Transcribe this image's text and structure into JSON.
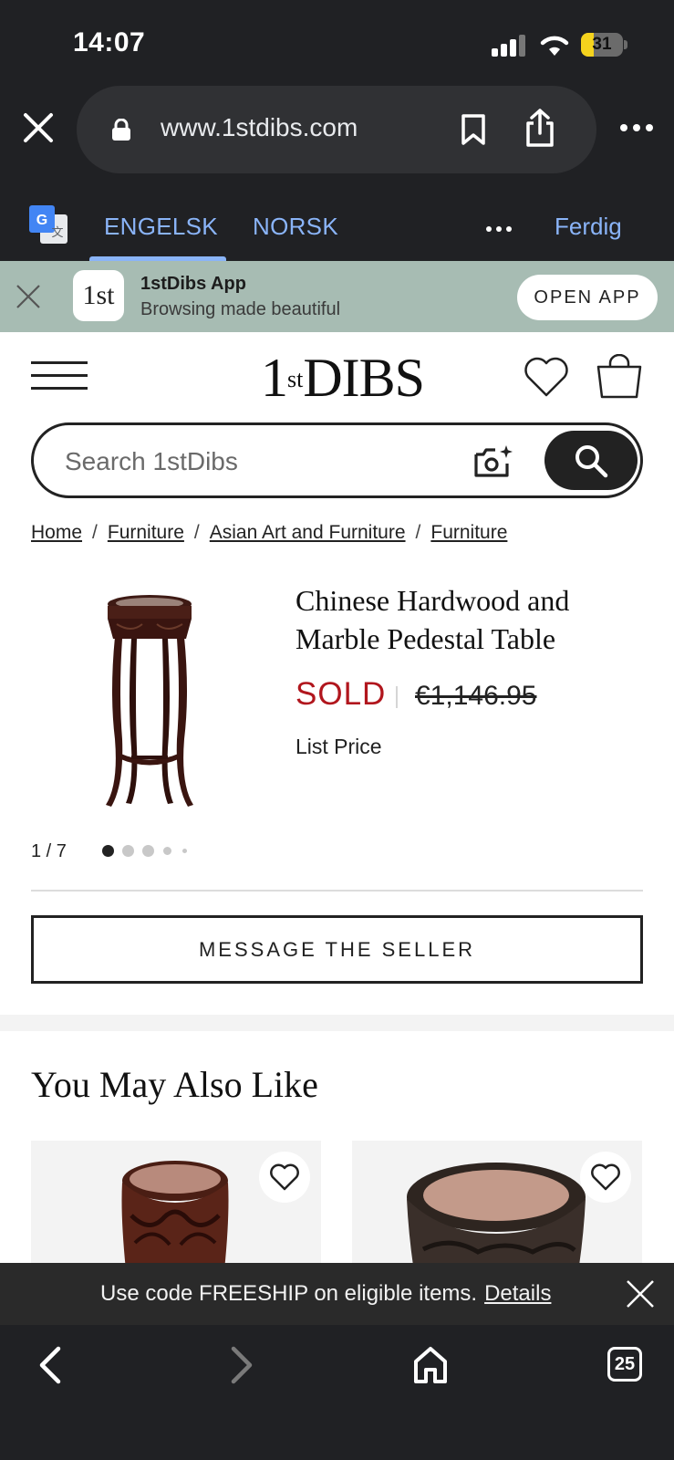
{
  "status_bar": {
    "time": "14:07",
    "battery": "31",
    "battery_level_percent": 31
  },
  "browser": {
    "url": "www.1stdibs.com"
  },
  "translate_bar": {
    "tab_source": "ENGELSK",
    "tab_target": "NORSK",
    "done_label": "Ferdig"
  },
  "app_banner": {
    "logo_text": "1st",
    "title": "1stDibs App",
    "subtitle": "Browsing made beautiful",
    "open_label": "OPEN APP"
  },
  "header": {
    "logo_part1": "1",
    "logo_sup": "st",
    "logo_part2": "DIBS"
  },
  "search": {
    "placeholder": "Search 1stDibs"
  },
  "breadcrumb": [
    "Home",
    "Furniture",
    "Asian Art and Furniture",
    "Furniture"
  ],
  "product": {
    "title": "Chinese Hardwood and Marble Pedestal Table",
    "status": "SOLD",
    "price": "€1,146.95",
    "price_note": "List Price",
    "image_counter": "1 / 7",
    "message_button": "MESSAGE THE SELLER"
  },
  "recommendations": {
    "title": "You May Also Like"
  },
  "promo": {
    "text": "Use code FREESHIP on eligible items.",
    "link": "Details"
  },
  "toolbar": {
    "tabs_count": "25"
  },
  "colors": {
    "browser_chrome": "#202124",
    "link_blue": "#8ab4f8",
    "banner_green": "#a7bcb3",
    "sold_red": "#b1161d",
    "battery_yellow": "#f5d31d"
  },
  "icons": [
    "close-icon",
    "lock-icon",
    "bookmark-icon",
    "share-icon",
    "more-icon",
    "google-translate-icon",
    "hamburger-icon",
    "heart-icon",
    "bag-icon",
    "camera-icon",
    "search-icon",
    "back-icon",
    "forward-icon",
    "home-icon",
    "tabs-icon"
  ]
}
